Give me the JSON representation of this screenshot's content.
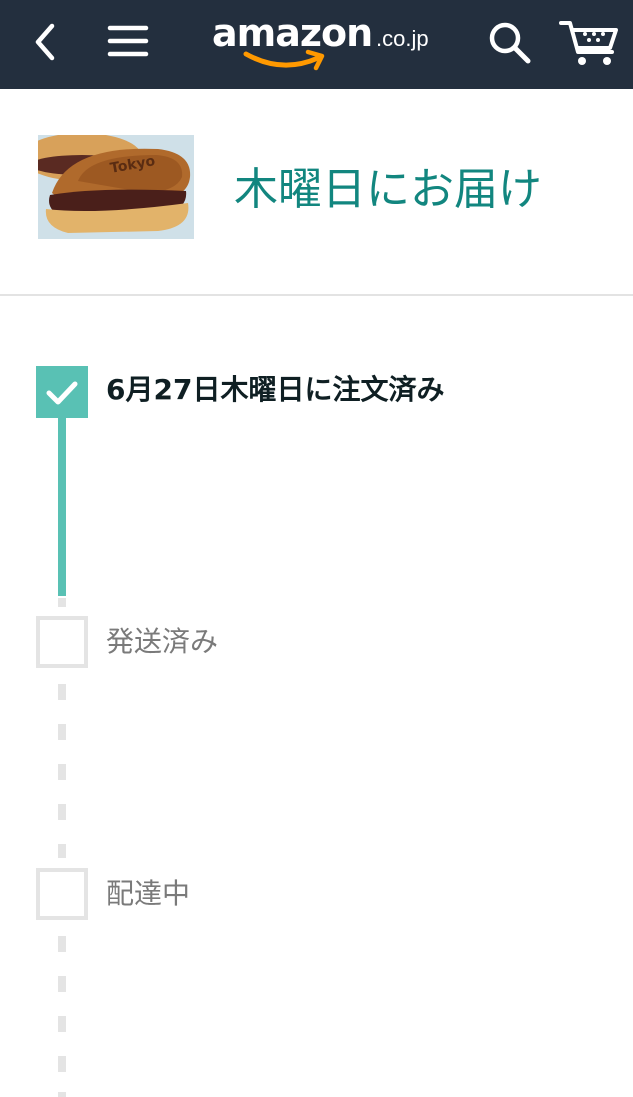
{
  "header": {
    "logo_word": "amazon",
    "logo_tld": ".co.jp",
    "icons": {
      "back": "back-chevron-icon",
      "menu": "hamburger-menu-icon",
      "search": "search-icon",
      "cart": "cart-icon"
    },
    "colors": {
      "bar": "#232f3e",
      "smile": "#ff9900"
    }
  },
  "product": {
    "thumbnail_text": "Tokyo",
    "delivery_title": "木曜日にお届け"
  },
  "tracker": {
    "accent_color": "#59c1b4",
    "steps": [
      {
        "label": "6月27日木曜日に注文済み",
        "status": "done"
      },
      {
        "label": "発送済み",
        "status": "pending"
      },
      {
        "label": "配達中",
        "status": "pending"
      }
    ]
  }
}
